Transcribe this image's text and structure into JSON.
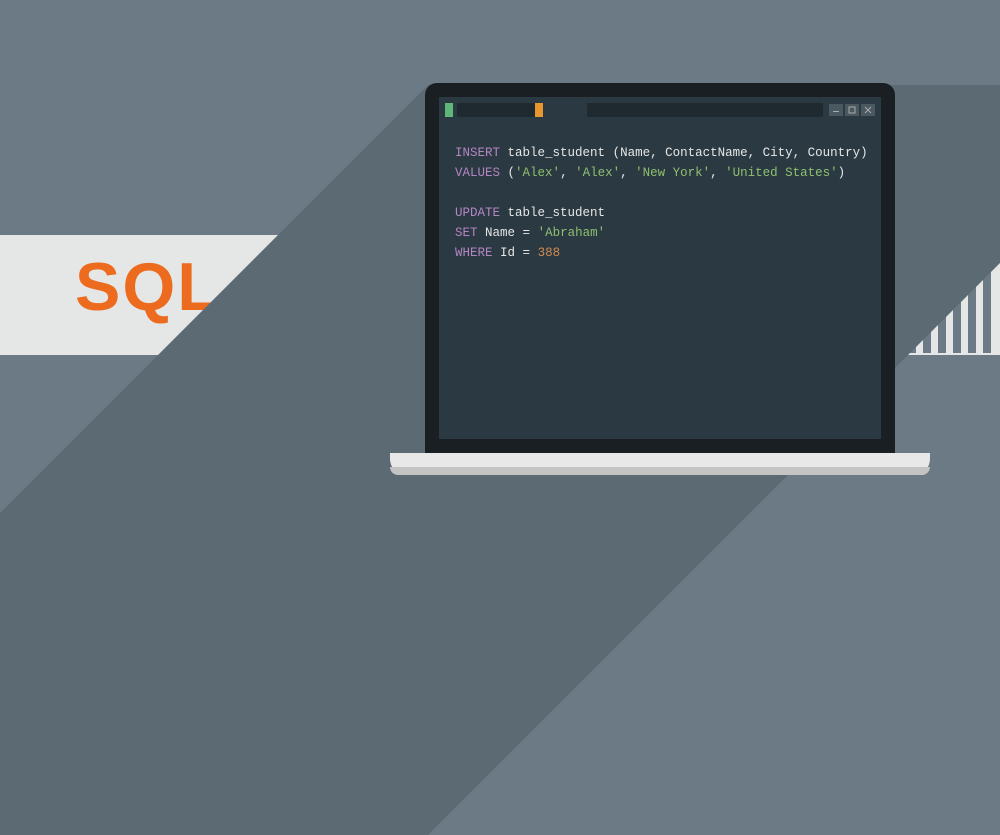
{
  "label": "SQL",
  "code": {
    "insert": {
      "keyword_insert": "INSERT",
      "table": "table_student",
      "columns": "(Name, ContactName, City, Country)",
      "keyword_values": "VALUES",
      "values": [
        "'Alex'",
        "'Alex'",
        "'New York'",
        "'United States'"
      ]
    },
    "update": {
      "keyword_update": "UPDATE",
      "table": "table_student",
      "keyword_set": "SET",
      "set_col": "Name",
      "set_eq": " = ",
      "set_val": "'Abraham'",
      "keyword_where": "WHERE",
      "where_col": "Id",
      "where_eq": " = ",
      "where_val": "388"
    }
  },
  "colors": {
    "bg": "#6b7a85",
    "band": "#e5e6e6",
    "accent": "#ec6b1f",
    "terminal": "#2b3a42",
    "keyword": "#b584c4",
    "string": "#8fbf6f",
    "number": "#d18a4e"
  }
}
